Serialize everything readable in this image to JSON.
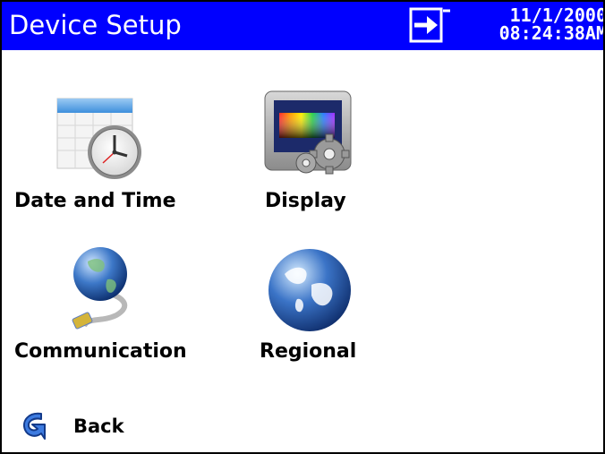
{
  "header": {
    "title": "Device Setup",
    "date": "11/1/2000",
    "time": "08:24:38AM",
    "io_icon": "exit-arrow-icon"
  },
  "tiles": [
    {
      "id": "date-and-time",
      "label": "Date and Time",
      "icon": "calendar-clock-icon"
    },
    {
      "id": "display",
      "label": "Display",
      "icon": "monitor-gears-icon"
    },
    {
      "id": "communication",
      "label": "Communication",
      "icon": "network-globe-icon"
    },
    {
      "id": "regional",
      "label": "Regional",
      "icon": "globe-icon"
    }
  ],
  "footer": {
    "back_label": "Back",
    "back_icon": "back-arrow-icon"
  },
  "colors": {
    "titlebar": "#0000ff",
    "text": "#000000",
    "background": "#ffffff"
  }
}
